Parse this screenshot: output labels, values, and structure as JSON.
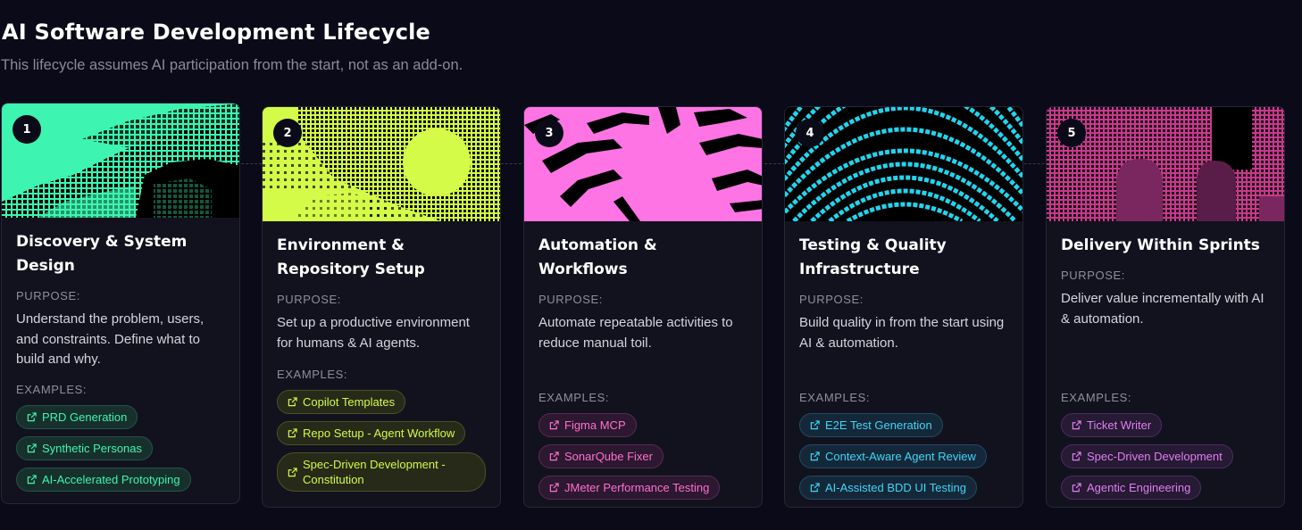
{
  "header": {
    "title": "AI Software Development Lifecycle",
    "subtitle": "This lifecycle assumes AI participation from the start, not as an add-on."
  },
  "labels": {
    "purpose": "PURPOSE:",
    "examples": "EXAMPLES:"
  },
  "stages": [
    {
      "number": "1",
      "title": "Discovery & System Design",
      "purpose": "Understand the problem, users, and constraints. Define what to build and why.",
      "accent": "#3df5b0",
      "examples": [
        "PRD Generation",
        "Synthetic Personas",
        "AI-Accelerated Prototyping"
      ]
    },
    {
      "number": "2",
      "title": "Environment & Repository Setup",
      "purpose": "Set up a productive environment for humans & AI agents.",
      "accent": "#d3fb48",
      "examples": [
        "Copilot Templates",
        "Repo Setup - Agent Workflow",
        "Spec-Driven Development - Constitution"
      ]
    },
    {
      "number": "3",
      "title": "Automation & Workflows",
      "purpose": "Automate repeatable activities to reduce manual toil.",
      "accent": "#ff74e5",
      "examples": [
        "Figma MCP",
        "SonarQube Fixer",
        "JMeter Performance Testing"
      ]
    },
    {
      "number": "4",
      "title": "Testing & Quality Infrastructure",
      "purpose": "Build quality in from the start using AI & automation.",
      "accent": "#1fd6f0",
      "examples": [
        "E2E Test Generation",
        "Context-Aware Agent Review",
        "AI-Assisted BDD UI Testing"
      ]
    },
    {
      "number": "5",
      "title": "Delivery Within Sprints",
      "purpose": "Deliver value incrementally with AI & automation.",
      "accent": "#c73a8e",
      "examples": [
        "Ticket Writer",
        "Spec-Driven Development",
        "Agentic Engineering"
      ]
    }
  ]
}
